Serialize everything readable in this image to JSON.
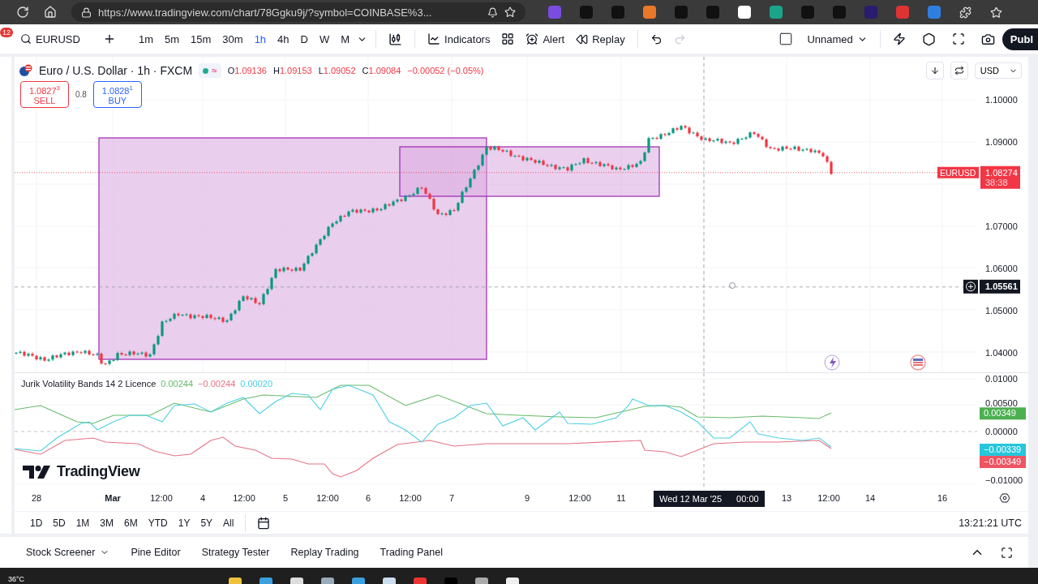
{
  "browser": {
    "url": "https://www.tradingview.com/chart/78Ggku9j/?symbol=COINBASE%3..."
  },
  "notification_badge": "12",
  "toolbar": {
    "symbol": "EURUSD",
    "intervals": [
      {
        "label": "1m",
        "selected": false
      },
      {
        "label": "5m",
        "selected": false
      },
      {
        "label": "15m",
        "selected": false
      },
      {
        "label": "30m",
        "selected": false
      },
      {
        "label": "1h",
        "selected": true
      },
      {
        "label": "4h",
        "selected": false
      },
      {
        "label": "D",
        "selected": false
      },
      {
        "label": "W",
        "selected": false
      },
      {
        "label": "M",
        "selected": false
      }
    ],
    "indicators": "Indicators",
    "alert": "Alert",
    "replay": "Replay",
    "layout_name": "Unnamed",
    "publish": "Publ"
  },
  "legend": {
    "title": "Euro / U.S. Dollar · 1h · FXCM",
    "status_mark": "≈",
    "ohlc": [
      {
        "label": "O",
        "value": "1.09136"
      },
      {
        "label": "H",
        "value": "1.09153"
      },
      {
        "label": "L",
        "value": "1.09052"
      },
      {
        "label": "C",
        "value": "1.09084"
      }
    ],
    "change": "−0.00052 (−0.05%)"
  },
  "quote": {
    "sell": {
      "price": "1.0827$^{3}$",
      "label": "SELL"
    },
    "spread": "0.8",
    "buy": {
      "price": "1.0828$^{1}$",
      "label": "BUY"
    }
  },
  "currency": "USD",
  "price_axis": [
    "1.10000",
    "1.09000",
    "1.07000",
    "1.06000",
    "1.05000",
    "1.04000"
  ],
  "last_price": {
    "symbol": "EURUSD",
    "price": "1.08274",
    "countdown": "38:38"
  },
  "crosshair": {
    "price": "1.05561",
    "date": "Wed 12 Mar '25",
    "time": "00:00"
  },
  "indicator": {
    "name": "Jurik Volatility Bands 14 2 Licence",
    "values": [
      {
        "text": "0.00244",
        "color": "#66bb6a"
      },
      {
        "text": "−0.00244",
        "color": "#e57385"
      },
      {
        "text": "0.00020",
        "color": "#4dd0e1"
      }
    ],
    "axis": [
      "0.01000",
      "0.00500",
      "0.00000",
      "−0.01000"
    ],
    "tags": [
      {
        "text": "0.00349",
        "color": "#4caf50"
      },
      {
        "text": "−0.00339",
        "color": "#26c6da"
      },
      {
        "text": "−0.00349",
        "color": "#f05361"
      }
    ]
  },
  "chart_logo": "TradingView",
  "time_axis": [
    {
      "label": "28",
      "bold": false
    },
    {
      "label": "Mar",
      "bold": true
    },
    {
      "label": "12:00",
      "bold": false
    },
    {
      "label": "4",
      "bold": false
    },
    {
      "label": "12:00",
      "bold": false
    },
    {
      "label": "5",
      "bold": false
    },
    {
      "label": "12:00",
      "bold": false
    },
    {
      "label": "6",
      "bold": false
    },
    {
      "label": "12:00",
      "bold": false
    },
    {
      "label": "7",
      "bold": false
    },
    {
      "label": "9",
      "bold": false
    },
    {
      "label": "12:00",
      "bold": false
    },
    {
      "label": "11",
      "bold": false
    },
    {
      "label": "13",
      "bold": false
    },
    {
      "label": "12:00",
      "bold": false
    },
    {
      "label": "14",
      "bold": false
    },
    {
      "label": "16",
      "bold": false
    }
  ],
  "ranges": [
    "1D",
    "5D",
    "1M",
    "3M",
    "6M",
    "YTD",
    "1Y",
    "5Y",
    "All"
  ],
  "clock": "13:21:21 UTC",
  "panel_tabs": [
    {
      "label": "Stock Screener",
      "has_menu": true
    },
    {
      "label": "Pine Editor",
      "has_menu": false
    },
    {
      "label": "Strategy Tester",
      "has_menu": false
    },
    {
      "label": "Replay Trading",
      "has_menu": false
    },
    {
      "label": "Trading Panel",
      "has_menu": false
    }
  ],
  "weather": "36°C"
}
